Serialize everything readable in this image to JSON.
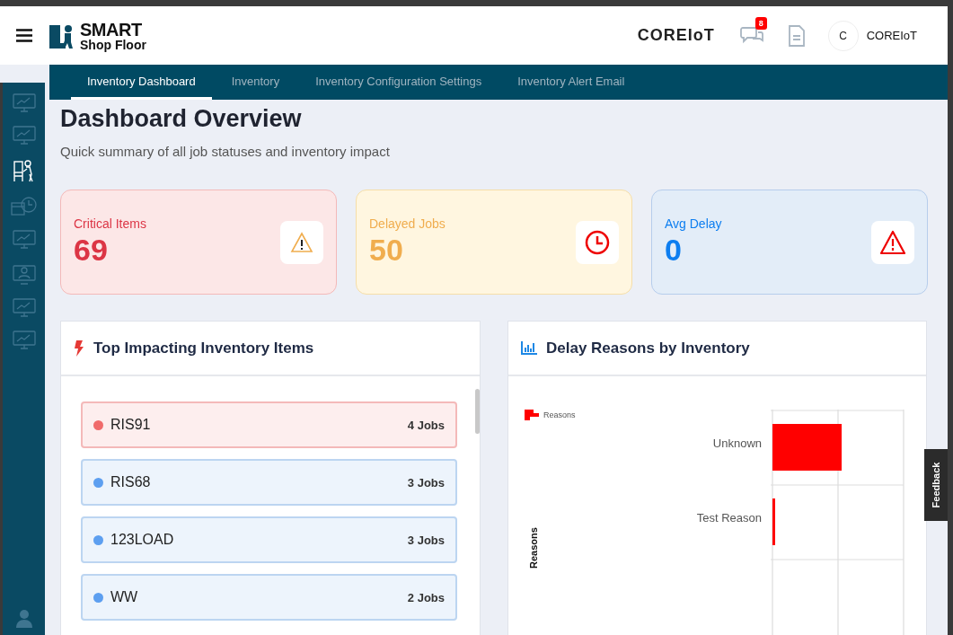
{
  "header": {
    "logo": {
      "line1": "SMART",
      "line2": "Shop Floor"
    },
    "brand": "COREIoT",
    "notification_count": "8",
    "user": {
      "initial": "C",
      "name": "COREIoT"
    }
  },
  "sidebar": {
    "items": [
      {
        "kind": "monitor",
        "selected": false
      },
      {
        "kind": "monitor",
        "selected": false
      },
      {
        "kind": "worker",
        "selected": true
      },
      {
        "kind": "schedule",
        "selected": false
      },
      {
        "kind": "monitor",
        "selected": false
      },
      {
        "kind": "user",
        "selected": false
      },
      {
        "kind": "monitor",
        "selected": false
      },
      {
        "kind": "monitor",
        "selected": false
      }
    ]
  },
  "tabs": [
    {
      "label": "Inventory Dashboard",
      "selected": true
    },
    {
      "label": "Inventory",
      "selected": false
    },
    {
      "label": "Inventory Configuration Settings",
      "selected": false
    },
    {
      "label": "Inventory Alert Email",
      "selected": false
    }
  ],
  "page": {
    "title": "Dashboard Overview",
    "subtitle": "Quick summary of all job statuses and inventory impact"
  },
  "stats": [
    {
      "kind": "critical",
      "label": "Critical Items",
      "value": "69"
    },
    {
      "kind": "delayed",
      "label": "Delayed Jobs",
      "value": "50"
    },
    {
      "kind": "delay",
      "label": "Avg Delay",
      "value": "0"
    }
  ],
  "inventory_panel": {
    "title": "Top Impacting Inventory Items",
    "items": [
      {
        "name": "RIS91",
        "jobs": "4 Jobs",
        "critical": true,
        "color": "#f06b6b"
      },
      {
        "name": "RIS68",
        "jobs": "3 Jobs",
        "critical": false,
        "color": "#5d9ff0"
      },
      {
        "name": "123LOAD",
        "jobs": "3 Jobs",
        "critical": false,
        "color": "#5d9ff0"
      },
      {
        "name": "WW",
        "jobs": "2 Jobs",
        "critical": false,
        "color": "#5d9ff0"
      }
    ]
  },
  "delay_panel": {
    "title": "Delay Reasons by Inventory",
    "legend": "Reasons",
    "ylabel": "Reasons",
    "categories": [
      "Unknown",
      "Test Reason"
    ]
  },
  "feedback": "Feedback"
}
